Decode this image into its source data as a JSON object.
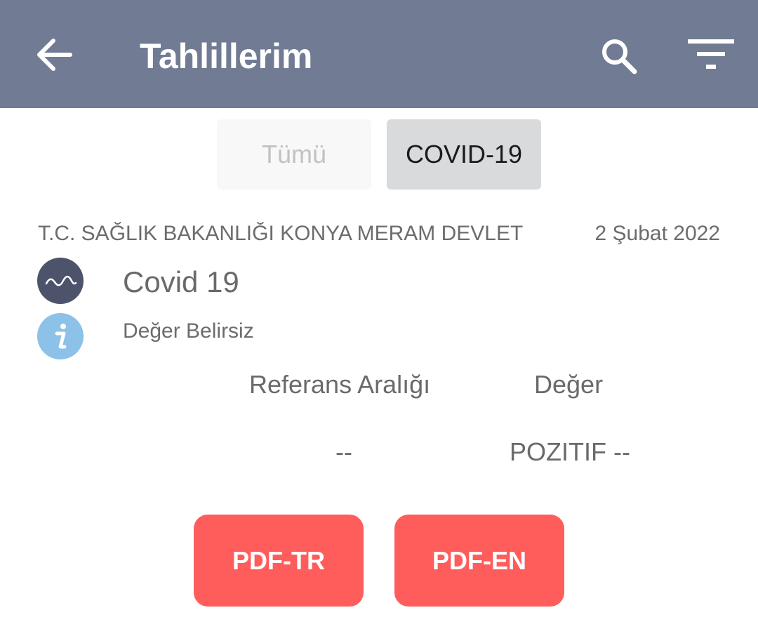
{
  "app_bar": {
    "title": "Tahlillerim",
    "back_icon": "arrow-left-icon",
    "search_icon": "search-icon",
    "filter_icon": "filter-icon",
    "background_color": "#717b94"
  },
  "tabs": [
    {
      "label": "Tümü",
      "selected": false
    },
    {
      "label": "COVID-19",
      "selected": true
    }
  ],
  "result": {
    "hospital": "T.C. SAĞLIK BAKANLIĞI KONYA MERAM DEVLET",
    "date": "2 Şubat 2022",
    "test_icon": "wave-icon",
    "test_name": "Covid 19",
    "status_icon": "info-icon",
    "status": "Değer Belirsiz",
    "table": {
      "headers": [
        "Referans Aralığı",
        "Değer"
      ],
      "rows": [
        [
          "--",
          "POZITIF --"
        ]
      ]
    }
  },
  "actions": {
    "pdf_tr": "PDF-TR",
    "pdf_en": "PDF-EN",
    "button_color": "#ff5c5c"
  }
}
